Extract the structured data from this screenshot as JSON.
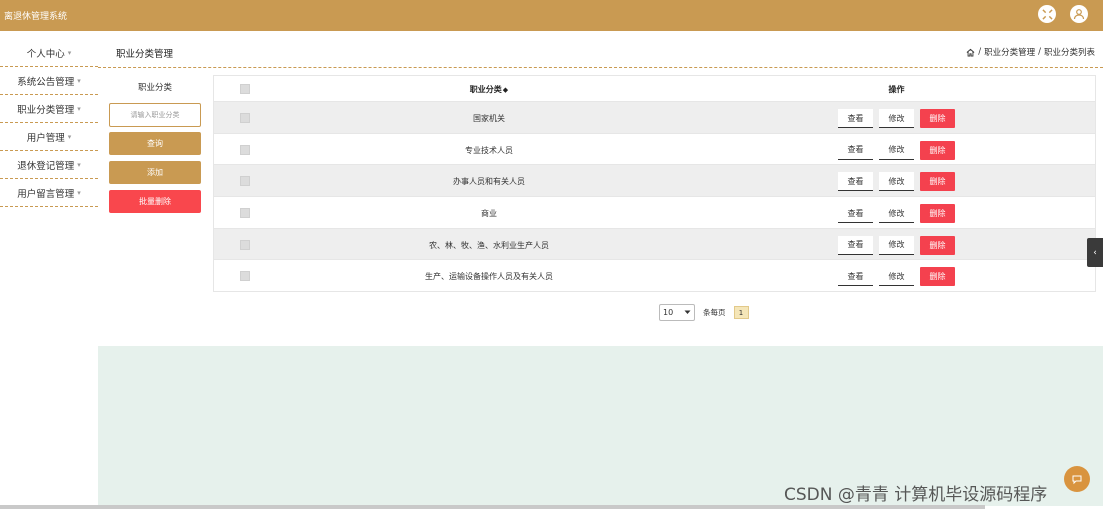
{
  "app": {
    "title": "离退休管理系统"
  },
  "sidebar": {
    "items": [
      {
        "label": "个人中心"
      },
      {
        "label": "系统公告管理"
      },
      {
        "label": "职业分类管理"
      },
      {
        "label": "用户管理"
      },
      {
        "label": "退休登记管理"
      },
      {
        "label": "用户留言管理"
      }
    ],
    "caret": "▾"
  },
  "page": {
    "title": "职业分类管理",
    "breadcrumb": [
      "职业分类管理",
      "职业分类列表"
    ],
    "breadcrumb_sep": "/"
  },
  "filter": {
    "label": "职业分类",
    "placeholder": "请输入职业分类",
    "search_label": "查询",
    "add_label": "添加",
    "batch_delete_label": "批量删除"
  },
  "table": {
    "headers": {
      "name": "职业分类",
      "sort": "◆",
      "ops": "操作"
    },
    "rows": [
      {
        "name": "国家机关"
      },
      {
        "name": "专业技术人员"
      },
      {
        "name": "办事人员和有关人员"
      },
      {
        "name": "商业"
      },
      {
        "name": "农、林、牧、渔、水利业生产人员"
      },
      {
        "name": "生产、运输设备操作人员及有关人员"
      }
    ],
    "op_labels": {
      "view": "查看",
      "edit": "修改",
      "delete": "删除"
    }
  },
  "pagination": {
    "page_size": "10",
    "per_page_label": "条每页",
    "current_page": "1"
  },
  "watermark": "CSDN @青青 计算机毕设源码程序",
  "colors": {
    "brand": "#c99a52",
    "danger": "#f4414e",
    "pink": "#f9474d",
    "panel": "#e6f1ec"
  }
}
